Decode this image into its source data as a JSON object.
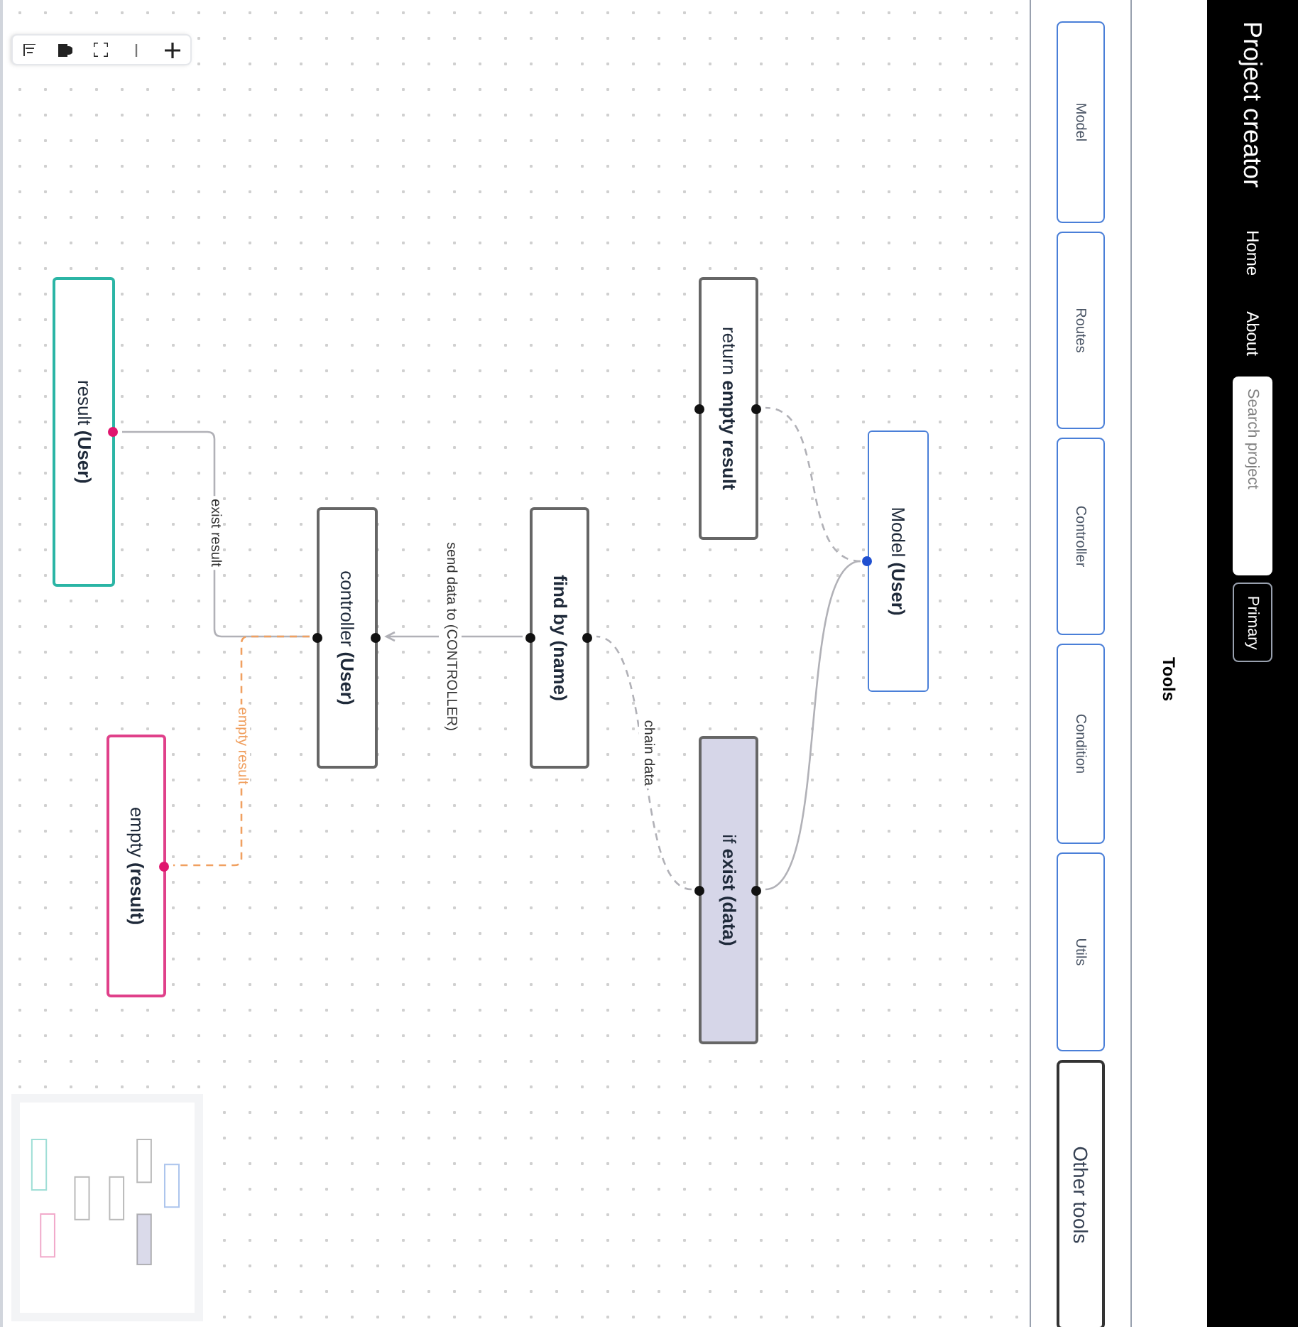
{
  "navbar": {
    "brand": "Project creator",
    "links": [
      {
        "label": "Home"
      },
      {
        "label": "About"
      }
    ],
    "search": {
      "placeholder": "Search project"
    },
    "button": "Primary"
  },
  "tools": {
    "title": "Tools",
    "items": [
      {
        "label": "Model",
        "kind": "outline"
      },
      {
        "label": "Routes",
        "kind": "outline"
      },
      {
        "label": "Controller",
        "kind": "outline"
      },
      {
        "label": "Condition",
        "kind": "outline"
      },
      {
        "label": "Utils",
        "kind": "outline"
      },
      {
        "label": "Other tools",
        "kind": "dark"
      }
    ]
  },
  "flow": {
    "nodes": [
      {
        "text": "Model **(User)**",
        "kind": "plain",
        "color": "#4a7fd8",
        "handles": [
          {
            "color": "#1f4fd0"
          }
        ]
      },
      {
        "text": "return **empty result**",
        "kind": "plain",
        "color": "#666666",
        "handles": [
          {
            "color": "#111111"
          },
          {
            "color": "#111111"
          }
        ]
      },
      {
        "text": "if **exist (data)**",
        "kind": "filled",
        "color": "#666666",
        "handles": [
          {
            "color": "#111111"
          },
          {
            "color": "#111111"
          }
        ]
      },
      {
        "text": "**find by (name)**",
        "kind": "plain",
        "color": "#666666",
        "handles": [
          {
            "color": "#111111"
          },
          {
            "color": "#111111"
          }
        ]
      },
      {
        "text": "controller **(User)**",
        "kind": "plain",
        "color": "#666666",
        "handles": [
          {
            "color": "#111111"
          },
          {
            "color": "#111111"
          }
        ]
      },
      {
        "text": "result **(User)**",
        "kind": "plain",
        "color": "#2bb5a5",
        "handles": [
          {
            "color": "#e0156e"
          }
        ]
      },
      {
        "text": "empty **(result)**",
        "kind": "plain",
        "color": "#e0408a",
        "handles": [
          {
            "color": "#e0156e"
          }
        ]
      }
    ],
    "edges": [
      {
        "dashed": true,
        "color": "#b1b1b7"
      },
      {
        "dashed": false,
        "color": "#b1b1b7"
      },
      {
        "label": "chain data",
        "dashed": true,
        "color": "#b1b1b7"
      },
      {
        "label": "send data to (CONTROLLER)",
        "dashed": false,
        "color": "#b1b1b7"
      },
      {
        "label": "exist result",
        "dashed": false,
        "color": "#b1b1b7"
      },
      {
        "label": "empty result",
        "dashed": true,
        "color": "#f0a060"
      }
    ]
  }
}
